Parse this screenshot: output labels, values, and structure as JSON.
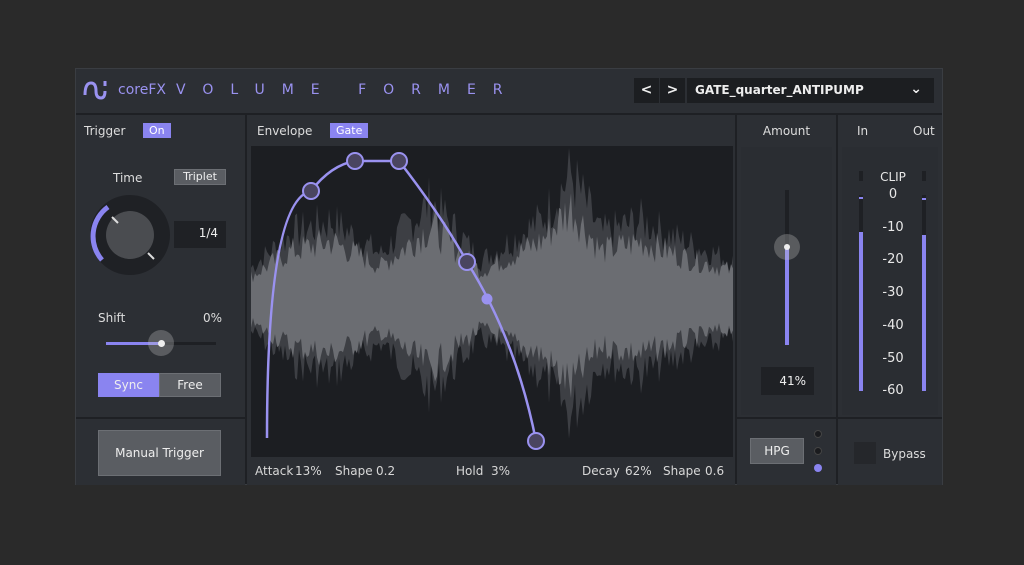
{
  "header": {
    "brand": "coreFX",
    "title": "VOLUME FORMER",
    "prev": "<",
    "next": ">",
    "preset": "GATE_quarter_ANTIPUMP"
  },
  "trigger": {
    "label": "Trigger",
    "state": "On",
    "time_label": "Time",
    "triplet": "Triplet",
    "time_value": "1/4",
    "shift_label": "Shift",
    "shift_value": "0%",
    "shift_fraction": 0.5,
    "sync": "Sync",
    "free": "Free",
    "manual": "Manual Trigger"
  },
  "envelope": {
    "label": "Envelope",
    "mode": "Gate",
    "attack_label": "Attack",
    "attack": "13%",
    "shape1_label": "Shape",
    "shape1": "0.2",
    "hold_label": "Hold",
    "hold": "3%",
    "decay_label": "Decay",
    "decay": "62%",
    "shape2_label": "Shape",
    "shape2": "0.6"
  },
  "amount": {
    "label": "Amount",
    "value": "41%",
    "hpg": "HPG"
  },
  "meters": {
    "in": "In",
    "out": "Out",
    "clip": "CLIP",
    "ticks": [
      "0",
      "-10",
      "-20",
      "-30",
      "-40",
      "-50",
      "-60"
    ],
    "bypass": "Bypass"
  },
  "colors": {
    "accent": "#8a84f0"
  }
}
